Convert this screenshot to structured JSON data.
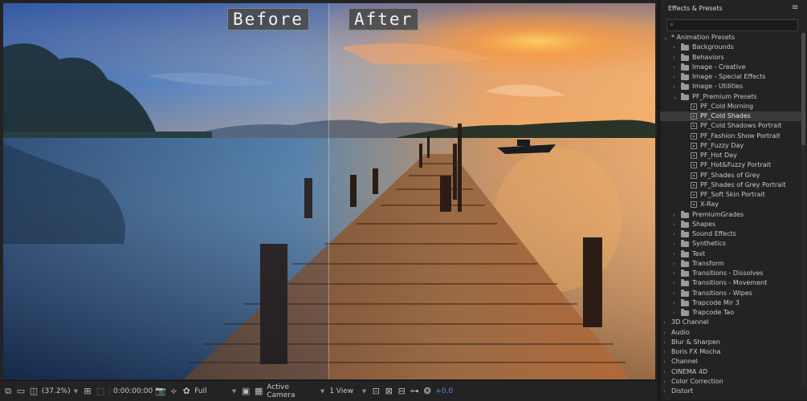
{
  "comparison": {
    "before_label": "Before",
    "after_label": "After"
  },
  "toolbar": {
    "zoom": "(37.2%)",
    "timecode": "0:00:00:00",
    "resolution": "Full",
    "camera": "Active Camera",
    "view": "1 View",
    "exposure": "+0.0"
  },
  "effects_panel": {
    "title": "Effects & Presets",
    "search_placeholder": "",
    "tree": [
      {
        "label": "* Animation Presets",
        "level": 0,
        "expanded": true,
        "type": "group"
      },
      {
        "label": "Backgrounds",
        "level": 1,
        "expanded": false,
        "type": "folder"
      },
      {
        "label": "Behaviors",
        "level": 1,
        "expanded": false,
        "type": "folder"
      },
      {
        "label": "Image - Creative",
        "level": 1,
        "expanded": false,
        "type": "folder"
      },
      {
        "label": "Image - Special Effects",
        "level": 1,
        "expanded": false,
        "type": "folder"
      },
      {
        "label": "Image - Utilities",
        "level": 1,
        "expanded": false,
        "type": "folder"
      },
      {
        "label": "PF_Premium Presets",
        "level": 1,
        "expanded": true,
        "type": "folder"
      },
      {
        "label": "PF_Cold Morning",
        "level": 2,
        "type": "preset"
      },
      {
        "label": "PF_Cold Shades",
        "level": 2,
        "type": "preset",
        "selected": true
      },
      {
        "label": "PF_Cold Shadows Portrait",
        "level": 2,
        "type": "preset"
      },
      {
        "label": "PF_Fashion Show Portrait",
        "level": 2,
        "type": "preset"
      },
      {
        "label": "PF_Fuzzy Day",
        "level": 2,
        "type": "preset"
      },
      {
        "label": "PF_Hot Day",
        "level": 2,
        "type": "preset"
      },
      {
        "label": "PF_Hot&Fuzzy Portrait",
        "level": 2,
        "type": "preset"
      },
      {
        "label": "PF_Shades of Grey",
        "level": 2,
        "type": "preset"
      },
      {
        "label": "PF_Shades of Grey Portrait",
        "level": 2,
        "type": "preset"
      },
      {
        "label": "PF_Soft Skin Portrait",
        "level": 2,
        "type": "preset"
      },
      {
        "label": "X-Ray",
        "level": 2,
        "type": "preset"
      },
      {
        "label": "PremiumGrades",
        "level": 1,
        "expanded": false,
        "type": "folder"
      },
      {
        "label": "Shapes",
        "level": 1,
        "expanded": false,
        "type": "folder"
      },
      {
        "label": "Sound Effects",
        "level": 1,
        "expanded": false,
        "type": "folder"
      },
      {
        "label": "Synthetics",
        "level": 1,
        "expanded": false,
        "type": "folder"
      },
      {
        "label": "Text",
        "level": 1,
        "expanded": false,
        "type": "folder"
      },
      {
        "label": "Transform",
        "level": 1,
        "expanded": false,
        "type": "folder"
      },
      {
        "label": "Transitions - Dissolves",
        "level": 1,
        "expanded": false,
        "type": "folder"
      },
      {
        "label": "Transitions - Movement",
        "level": 1,
        "expanded": false,
        "type": "folder"
      },
      {
        "label": "Transitions - Wipes",
        "level": 1,
        "expanded": false,
        "type": "folder"
      },
      {
        "label": "Trapcode Mir 3",
        "level": 1,
        "expanded": false,
        "type": "folder"
      },
      {
        "label": "Trapcode Tao",
        "level": 1,
        "expanded": false,
        "type": "folder"
      },
      {
        "label": "3D Channel",
        "level": 0,
        "expanded": false,
        "type": "category"
      },
      {
        "label": "Audio",
        "level": 0,
        "expanded": false,
        "type": "category"
      },
      {
        "label": "Blur & Sharpen",
        "level": 0,
        "expanded": false,
        "type": "category"
      },
      {
        "label": "Boris FX Mocha",
        "level": 0,
        "expanded": false,
        "type": "category"
      },
      {
        "label": "Channel",
        "level": 0,
        "expanded": false,
        "type": "category"
      },
      {
        "label": "CINEMA 4D",
        "level": 0,
        "expanded": false,
        "type": "category"
      },
      {
        "label": "Color Correction",
        "level": 0,
        "expanded": false,
        "type": "category"
      },
      {
        "label": "Distort",
        "level": 0,
        "expanded": false,
        "type": "category"
      }
    ]
  },
  "colors": {
    "panel_bg": "#232323",
    "selection_bg": "#3a3a3a",
    "accent_blue": "#5a8fe0"
  }
}
